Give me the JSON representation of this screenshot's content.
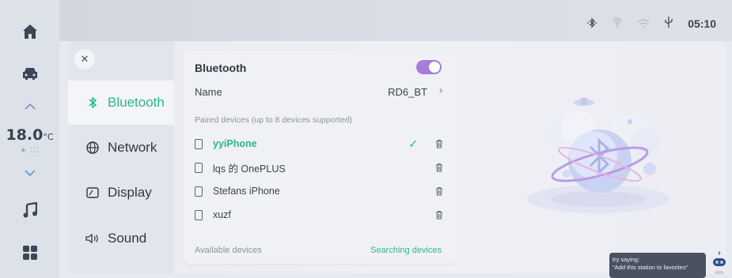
{
  "rail": {
    "temperature": "18.0",
    "temperature_unit": "°C",
    "fan_level": "∗ ⁚⁚⁚"
  },
  "status_bar": {
    "time": "05:10",
    "icons": [
      "bluetooth-icon",
      "hotspot-icon",
      "wifi-icon",
      "usb-icon"
    ]
  },
  "settings_nav": {
    "items": [
      {
        "label": "Bluetooth",
        "icon": "bluetooth-icon",
        "active": true
      },
      {
        "label": "Network",
        "icon": "globe-icon",
        "active": false
      },
      {
        "label": "Display",
        "icon": "display-icon",
        "active": false
      },
      {
        "label": "Sound",
        "icon": "speaker-icon",
        "active": false
      }
    ]
  },
  "bluetooth": {
    "title": "Bluetooth",
    "enabled": true,
    "name_label": "Name",
    "name_value": "RD6_BT",
    "paired_title": "Paired devices (up to 8 devices supported)",
    "paired_devices": [
      {
        "name": "yyiPhone",
        "connected": true
      },
      {
        "name": "lqs 的 OnePLUS",
        "connected": false
      },
      {
        "name": "Stefans iPhone",
        "connected": false
      },
      {
        "name": "xuzf",
        "connected": false
      }
    ],
    "available_label": "Available devices",
    "searching_label": "Searching devices"
  },
  "assistant": {
    "line1": "try saying:",
    "line2": "\"Add this station to favorites\""
  },
  "colors": {
    "accent": "#2bb58f",
    "toggle": "#a57ddb"
  }
}
